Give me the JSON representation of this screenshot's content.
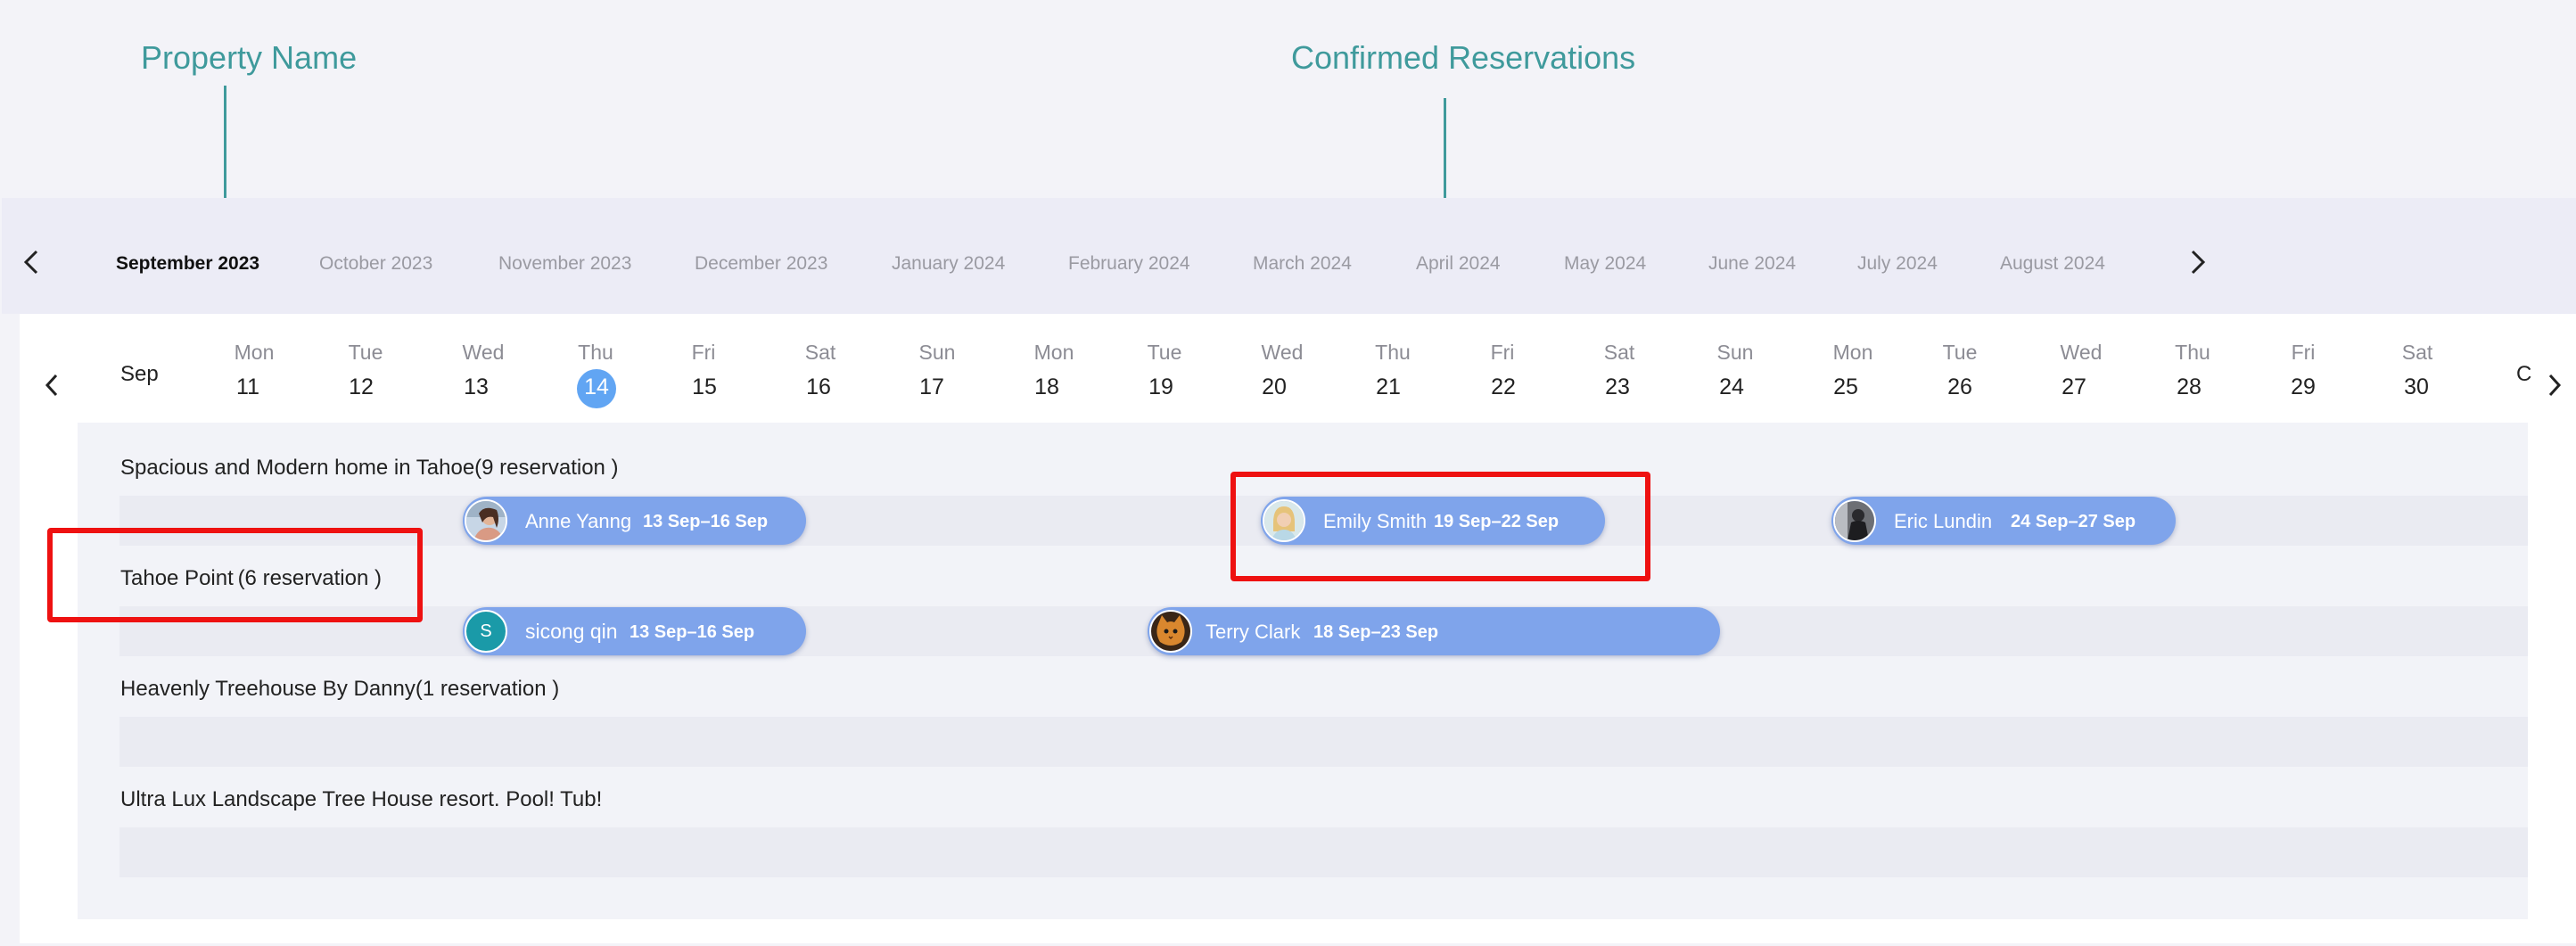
{
  "annotations": {
    "property_name": "Property Name",
    "confirmed_reservations": "Confirmed Reservations"
  },
  "months": {
    "prev_icon": "chevron-left-icon",
    "next_icon": "chevron-right-icon",
    "items": [
      "September 2023",
      "October 2023",
      "November 2023",
      "December 2023",
      "January 2024",
      "February 2024",
      "March 2024",
      "April 2024",
      "May 2024",
      "June 2024",
      "July 2024",
      "August 2024"
    ],
    "active": "September 2023"
  },
  "calendar": {
    "month_label": "Sep",
    "overflow_label": "C",
    "days": [
      {
        "dow": "Mon",
        "num": "11"
      },
      {
        "dow": "Tue",
        "num": "12"
      },
      {
        "dow": "Wed",
        "num": "13"
      },
      {
        "dow": "Thu",
        "num": "14"
      },
      {
        "dow": "Fri",
        "num": "15"
      },
      {
        "dow": "Sat",
        "num": "16"
      },
      {
        "dow": "Sun",
        "num": "17"
      },
      {
        "dow": "Mon",
        "num": "18"
      },
      {
        "dow": "Tue",
        "num": "19"
      },
      {
        "dow": "Wed",
        "num": "20"
      },
      {
        "dow": "Thu",
        "num": "21"
      },
      {
        "dow": "Fri",
        "num": "22"
      },
      {
        "dow": "Sat",
        "num": "23"
      },
      {
        "dow": "Sun",
        "num": "24"
      },
      {
        "dow": "Mon",
        "num": "25"
      },
      {
        "dow": "Tue",
        "num": "26"
      },
      {
        "dow": "Wed",
        "num": "27"
      },
      {
        "dow": "Thu",
        "num": "28"
      },
      {
        "dow": "Fri",
        "num": "29"
      },
      {
        "dow": "Sat",
        "num": "30"
      }
    ],
    "today": "14"
  },
  "properties": [
    {
      "label": "Spacious and Modern home in Tahoe(9 reservation )"
    },
    {
      "label": "Tahoe Point (6 reservation )"
    },
    {
      "label": "Heavenly Treehouse By Danny(1 reservation )"
    },
    {
      "label": "Ultra Lux Landscape Tree House resort. Pool! Tub!"
    }
  ],
  "reservations": [
    {
      "guest": "Anne Yanng",
      "dates": "13 Sep–16 Sep",
      "avatar": "photo-avatar-woman"
    },
    {
      "guest": "Emily Smith",
      "dates": "19 Sep–22 Sep",
      "avatar": "photo-avatar-blonde"
    },
    {
      "guest": "Eric Lundin",
      "dates": "24 Sep–27 Sep",
      "avatar": "photo-avatar-dark"
    },
    {
      "guest": "sicong qin",
      "dates": "13 Sep–16 Sep",
      "avatar": "initial-avatar",
      "initial": "S"
    },
    {
      "guest": "Terry Clark",
      "dates": "18 Sep–23 Sep",
      "avatar": "photo-avatar-cat"
    }
  ],
  "colors": {
    "annotation": "#3f9a9c",
    "highlight_box": "#ee1111",
    "reservation_bar": "#7fa4eb",
    "today_marker": "#61a5f3",
    "initial_avatar": "#1a9aa8"
  }
}
